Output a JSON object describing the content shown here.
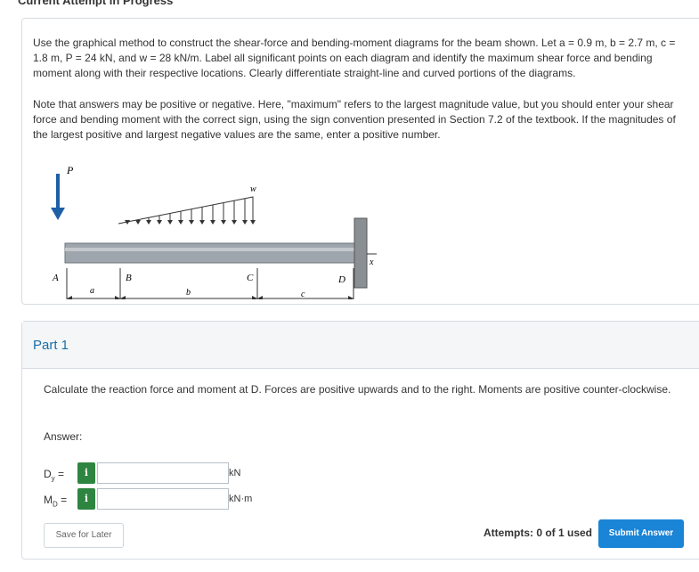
{
  "header": {
    "title": "Current Attempt in Progress"
  },
  "question": {
    "paragraph1": "Use the graphical method to construct the shear-force and bending-moment diagrams for the beam shown.  Let a = 0.9 m, b = 2.7 m, c = 1.8 m, P = 24 kN, and w = 28 kN/m.  Label all significant points on each diagram and identify the maximum shear force and bending moment along with their respective locations.  Clearly differentiate straight-line and curved portions of the diagrams.",
    "paragraph2": "Note that answers may be positive or negative. Here, \"maximum\" refers to the largest magnitude value, but you should enter your shear force and bending moment with the correct sign, using the sign convention presented in Section 7.2 of the textbook. If the magnitudes of the largest positive and largest negative values are the same, enter a positive number."
  },
  "figure": {
    "load_P": "P",
    "load_w": "w",
    "point_A": "A",
    "point_B": "B",
    "point_C": "C",
    "point_D": "D",
    "dim_a": "a",
    "dim_b": "b",
    "dim_c": "c",
    "axis_x": "x",
    "colors": {
      "beam": "#9ea5ad",
      "support": "#8a8f94",
      "arrow": "#1f5fa6"
    }
  },
  "part1": {
    "title": "Part 1",
    "question": "Calculate the reaction force and moment at D. Forces are positive upwards and to the right. Moments are positive counter-clockwise.",
    "answer_label": "Answer:",
    "fields": [
      {
        "label_main": "D",
        "label_sub": "y",
        "suffix": " =",
        "unit": "kN",
        "value": ""
      },
      {
        "label_main": "M",
        "label_sub": "D",
        "suffix": " =",
        "unit": "kN·m",
        "value": ""
      }
    ],
    "info_icon_label": "i",
    "save_label": "Save for Later",
    "attempts_text": "Attempts: 0 of 1 used",
    "submit_label": "Submit Answer"
  }
}
